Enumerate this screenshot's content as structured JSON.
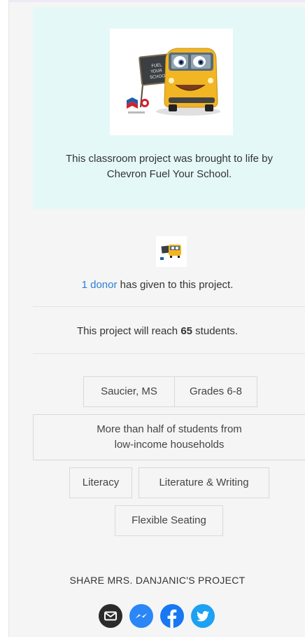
{
  "sponsor": {
    "image_alt": "Chevron Fuel Your School bus mascot",
    "board_text": "FUEL YOUR SCHOOL",
    "message": "This classroom project was brought to life by Chevron Fuel Your School."
  },
  "donors": {
    "link_text": "1 donor",
    "suffix": " has given to this project."
  },
  "reach": {
    "prefix": "This project will reach ",
    "count": "65",
    "suffix": " students."
  },
  "tags": {
    "location": "Saucier, MS",
    "grades": "Grades 6-8",
    "poverty": "More than half of students from low-income households",
    "subject_1": "Literacy",
    "subject_2": "Literature & Writing",
    "resource": "Flexible Seating"
  },
  "share": {
    "title": "SHARE MRS. DANJANIC'S PROJECT",
    "icons": [
      "email-icon",
      "messenger-icon",
      "facebook-icon",
      "twitter-icon"
    ]
  },
  "colors": {
    "sponsor_bg": "#e5f8f8",
    "link": "#2a7fd4",
    "messenger": "#2b86f6",
    "facebook": "#1877f2",
    "twitter": "#1da1f2",
    "email": "#2b2b2b"
  }
}
